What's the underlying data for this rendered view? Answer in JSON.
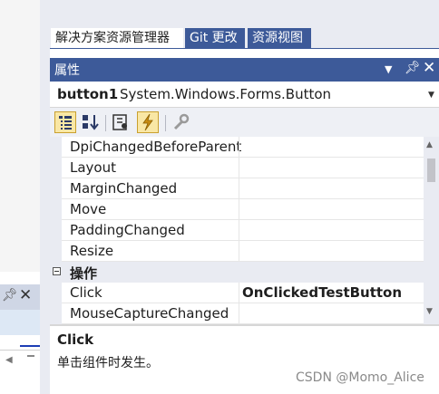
{
  "tabs": [
    {
      "label": "解决方案资源管理器",
      "active": true
    },
    {
      "label": "Git 更改",
      "active": false
    },
    {
      "label": "资源视图",
      "active": false
    }
  ],
  "panel": {
    "title": "属性",
    "object_name": "button1",
    "object_type": "System.Windows.Forms.Button"
  },
  "toolbar": {
    "buttons": [
      "categorized-icon",
      "alphabetical-icon",
      "properties-icon",
      "events-icon",
      "property-pages-icon"
    ]
  },
  "grid": {
    "rows_before": [
      {
        "label": "DpiChangedBeforeParent",
        "value": ""
      },
      {
        "label": "Layout",
        "value": ""
      },
      {
        "label": "MarginChanged",
        "value": ""
      },
      {
        "label": "Move",
        "value": ""
      },
      {
        "label": "PaddingChanged",
        "value": ""
      },
      {
        "label": "Resize",
        "value": ""
      }
    ],
    "category": "操作",
    "rows_after": [
      {
        "label": "Click",
        "value": "OnClickedTestButton"
      },
      {
        "label": "MouseCaptureChanged",
        "value": ""
      }
    ]
  },
  "description": {
    "title": "Click",
    "text": "单击组件时发生。"
  },
  "watermark": "CSDN @Momo_Alice",
  "colors": {
    "accent": "#3d5a99",
    "chrome": "#e9ebf2",
    "active_button": "#f9e7a5"
  }
}
